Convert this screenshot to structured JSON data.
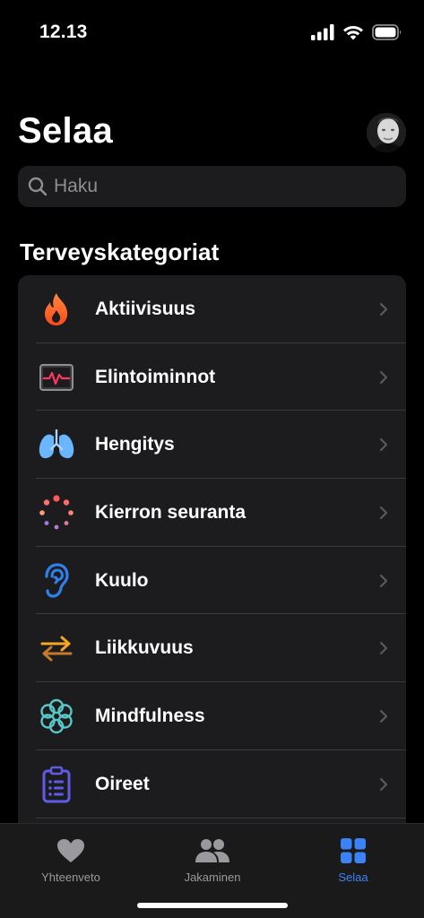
{
  "status_bar": {
    "time": "12.13"
  },
  "header": {
    "title": "Selaa"
  },
  "search": {
    "placeholder": "Haku"
  },
  "section": {
    "title": "Terveyskategoriat"
  },
  "categories": [
    {
      "label": "Aktiivisuus",
      "icon": "flame-icon",
      "color": "#ff5a1f"
    },
    {
      "label": "Elintoiminnot",
      "icon": "vitals-monitor-icon",
      "color": "#ff375f"
    },
    {
      "label": "Hengitys",
      "icon": "lungs-icon",
      "color": "#64b5f6"
    },
    {
      "label": "Kierron seuranta",
      "icon": "cycle-tracking-icon",
      "color": "#ff6b6b"
    },
    {
      "label": "Kuulo",
      "icon": "ear-icon",
      "color": "#2f80ed"
    },
    {
      "label": "Liikkuvuus",
      "icon": "mobility-arrows-icon",
      "color": "#f5a623"
    },
    {
      "label": "Mindfulness",
      "icon": "mindfulness-flower-icon",
      "color": "#5ac8c8"
    },
    {
      "label": "Oireet",
      "icon": "clipboard-icon",
      "color": "#5e5ce6"
    }
  ],
  "tab_bar": {
    "tabs": [
      {
        "label": "Yhteenveto",
        "icon": "heart-icon"
      },
      {
        "label": "Jakaminen",
        "icon": "people-icon"
      },
      {
        "label": "Selaa",
        "icon": "grid-icon"
      }
    ],
    "active_color": "#3b82f6"
  }
}
